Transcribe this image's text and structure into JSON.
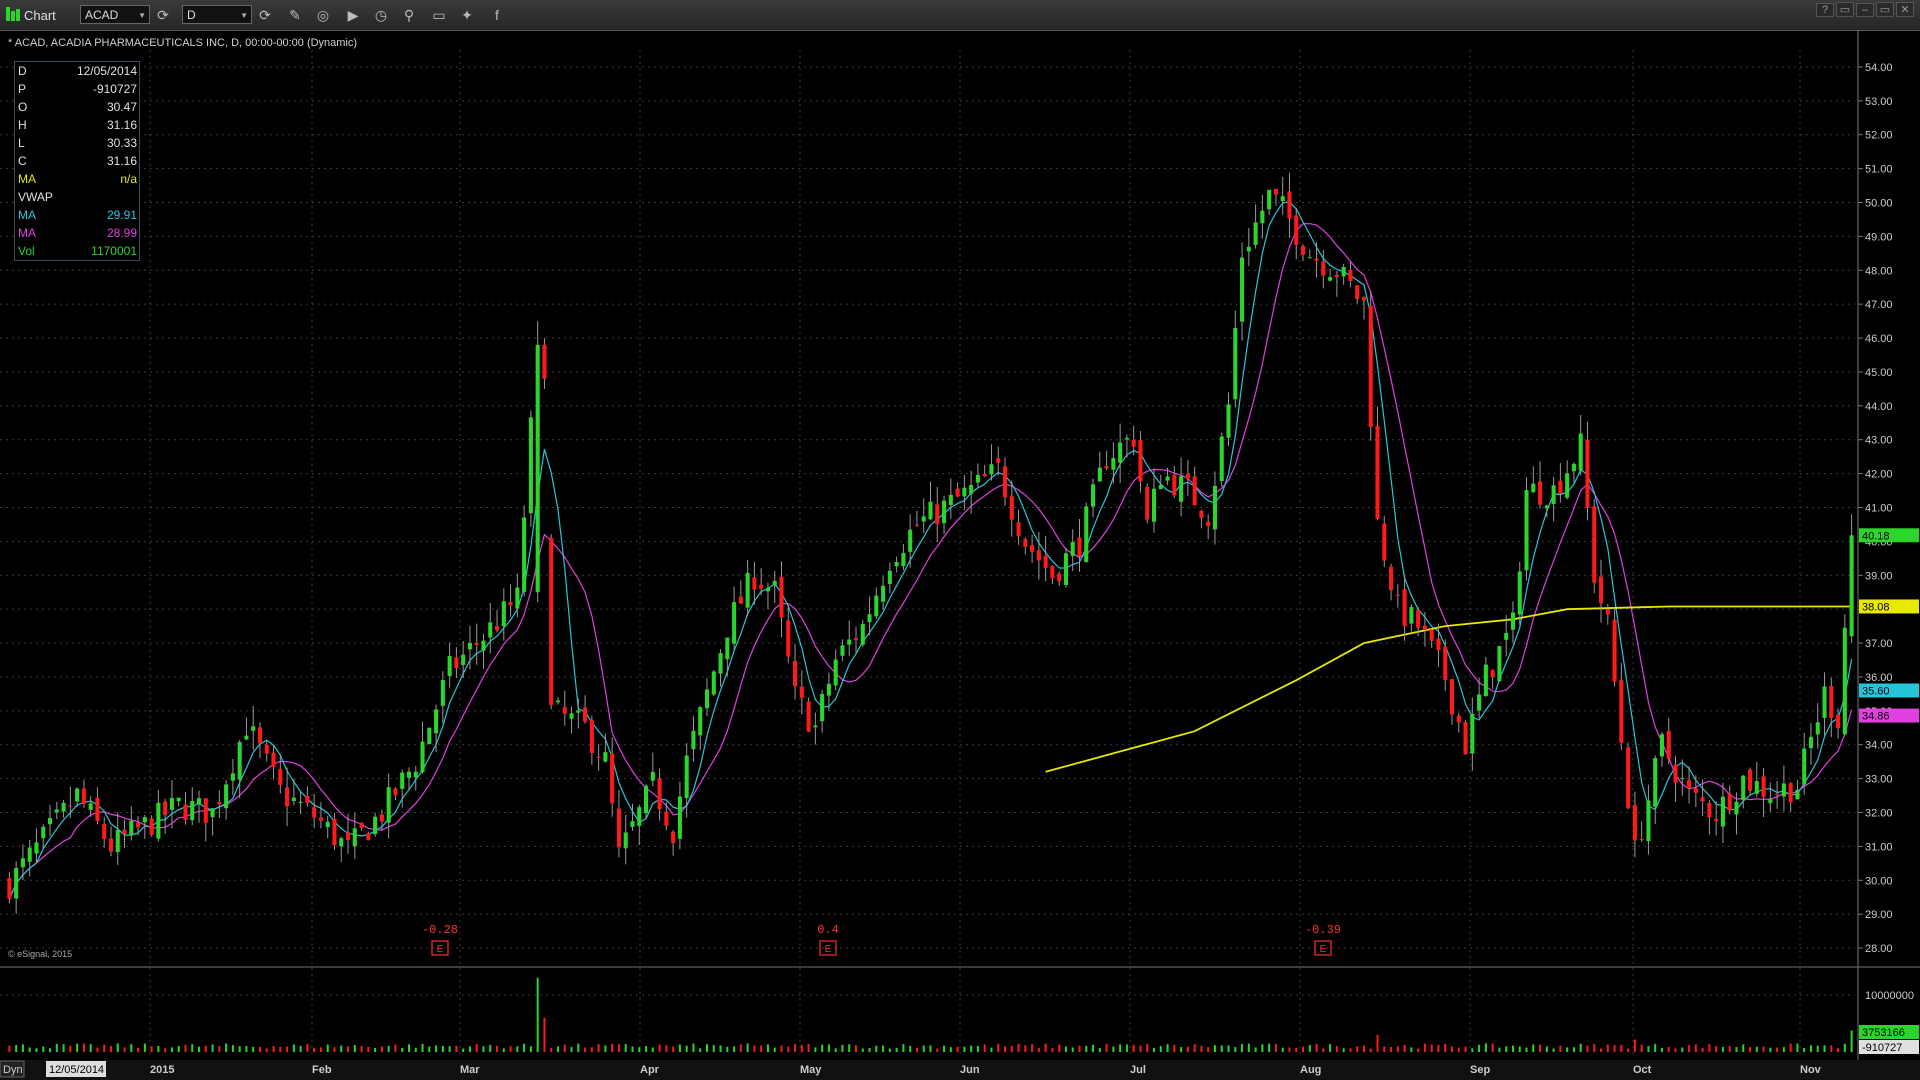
{
  "toolbar": {
    "title": "Chart",
    "symbol": "ACAD",
    "interval": "D",
    "window_buttons": [
      "?",
      "▭",
      "–",
      "▭",
      "✕"
    ]
  },
  "chart_header": "* ACAD, ACADIA PHARMACEUTICALS INC, D, 00:00-00:00 (Dynamic)",
  "copyright": "© eSignal, 2015",
  "info_panel": [
    {
      "k": "D",
      "v": "12/05/2014",
      "color": "#e0e0e0"
    },
    {
      "k": "P",
      "v": "-910727",
      "color": "#e0e0e0"
    },
    {
      "k": "O",
      "v": "30.47",
      "color": "#e0e0e0"
    },
    {
      "k": "H",
      "v": "31.16",
      "color": "#e0e0e0"
    },
    {
      "k": "L",
      "v": "30.33",
      "color": "#e0e0e0"
    },
    {
      "k": "C",
      "v": "31.16",
      "color": "#e0e0e0"
    },
    {
      "k": "MA",
      "v": "n/a",
      "color": "#e8e800"
    },
    {
      "k": "VWAP",
      "v": "",
      "color": "#e0e0e0"
    },
    {
      "k": "MA",
      "v": "29.91",
      "color": "#26c6da"
    },
    {
      "k": "MA",
      "v": "28.99",
      "color": "#e040e0"
    },
    {
      "k": "Vol",
      "v": "1170001",
      "color": "#2bd52b"
    }
  ],
  "status": {
    "dyn_label": "Dyn",
    "date": "12/05/2014"
  },
  "colors": {
    "up": "#2bd52b",
    "down": "#ff1a1a",
    "ma_fast": "#26c6da",
    "ma_slow": "#e040e0",
    "ma_long": "#e8e800",
    "grid": "#3a3a3a"
  },
  "chart_data": {
    "type": "candlestick",
    "symbol": "ACAD",
    "ylim": [
      27.5,
      54.5
    ],
    "y_ticks": [
      "28.00",
      "29.00",
      "30.00",
      "31.00",
      "32.00",
      "33.00",
      "34.00",
      "35.00",
      "36.00",
      "37.00",
      "38.00",
      "39.00",
      "40.00",
      "41.00",
      "42.00",
      "43.00",
      "44.00",
      "45.00",
      "46.00",
      "47.00",
      "48.00",
      "49.00",
      "50.00",
      "51.00",
      "52.00",
      "53.00",
      "54.00"
    ],
    "x_labels": [
      "2015",
      "Feb",
      "Mar",
      "Apr",
      "May",
      "Jun",
      "Jul",
      "Aug",
      "Sep",
      "Oct",
      "Nov"
    ],
    "price_badges": [
      {
        "label": "40.18",
        "value": 40.18,
        "color": "#2bd52b"
      },
      {
        "label": "38.08",
        "value": 38.08,
        "color": "#e8e800"
      },
      {
        "label": "35.60",
        "value": 35.6,
        "color": "#26c6da"
      },
      {
        "label": "34.86",
        "value": 34.86,
        "color": "#e040e0"
      }
    ],
    "earnings_events": [
      {
        "label": "-0.28",
        "marker": "E"
      },
      {
        "label": "0.4",
        "marker": "E"
      },
      {
        "label": "-0.39",
        "marker": "E"
      }
    ],
    "volume": {
      "y_ticks": [
        "10000000"
      ],
      "badges": [
        {
          "label": "3753166",
          "color": "#2bd52b"
        },
        {
          "label": "-910727",
          "color": "#e0e0e0"
        }
      ]
    },
    "anchors": [
      [
        0,
        29.9
      ],
      [
        5,
        31.2
      ],
      [
        10,
        32.5
      ],
      [
        15,
        31.0
      ],
      [
        20,
        31.6
      ],
      [
        25,
        32.2
      ],
      [
        30,
        32.0
      ],
      [
        35,
        34.6
      ],
      [
        40,
        32.6
      ],
      [
        45,
        31.9
      ],
      [
        50,
        30.9
      ],
      [
        55,
        32.0
      ],
      [
        60,
        33.5
      ],
      [
        65,
        36.2
      ],
      [
        70,
        37.2
      ],
      [
        75,
        38.3
      ],
      [
        78,
        45.8
      ],
      [
        80,
        35.0
      ],
      [
        85,
        34.5
      ],
      [
        88,
        33.5
      ],
      [
        90,
        30.7
      ],
      [
        95,
        32.8
      ],
      [
        98,
        31.5
      ],
      [
        100,
        33.5
      ],
      [
        103,
        35.5
      ],
      [
        106,
        37.5
      ],
      [
        110,
        39.0
      ],
      [
        113,
        38.5
      ],
      [
        116,
        35.4
      ],
      [
        119,
        34.5
      ],
      [
        122,
        36.5
      ],
      [
        126,
        37.5
      ],
      [
        130,
        39.5
      ],
      [
        134,
        40.5
      ],
      [
        138,
        41.0
      ],
      [
        142,
        41.5
      ],
      [
        146,
        42.1
      ],
      [
        150,
        40.0
      ],
      [
        154,
        39.0
      ],
      [
        158,
        40.0
      ],
      [
        162,
        42.5
      ],
      [
        166,
        43.1
      ],
      [
        168,
        40.5
      ],
      [
        170,
        42.0
      ],
      [
        174,
        41.5
      ],
      [
        177,
        40.8
      ],
      [
        180,
        44.0
      ],
      [
        182,
        48.5
      ],
      [
        186,
        50.2
      ],
      [
        188,
        49.8
      ],
      [
        192,
        48.5
      ],
      [
        196,
        48.0
      ],
      [
        200,
        47.0
      ],
      [
        202,
        40.5
      ],
      [
        205,
        38.0
      ],
      [
        208,
        37.5
      ],
      [
        212,
        36.0
      ],
      [
        215,
        34.0
      ],
      [
        218,
        36.0
      ],
      [
        222,
        37.5
      ],
      [
        224,
        41.5
      ],
      [
        228,
        41.5
      ],
      [
        232,
        42.8
      ],
      [
        234,
        39.0
      ],
      [
        236,
        37.5
      ],
      [
        240,
        30.8
      ],
      [
        244,
        34.0
      ],
      [
        248,
        32.5
      ],
      [
        252,
        32.0
      ],
      [
        256,
        33.0
      ],
      [
        260,
        32.6
      ],
      [
        264,
        32.8
      ],
      [
        268,
        35.5
      ],
      [
        270,
        34.8
      ],
      [
        272,
        40.18
      ]
    ],
    "ma_long_series": [
      [
        153,
        33.2
      ],
      [
        175,
        34.4
      ],
      [
        190,
        35.9
      ],
      [
        200,
        37.0
      ],
      [
        212,
        37.5
      ],
      [
        222,
        37.7
      ],
      [
        230,
        38.0
      ],
      [
        245,
        38.08
      ],
      [
        272,
        38.08
      ]
    ]
  }
}
